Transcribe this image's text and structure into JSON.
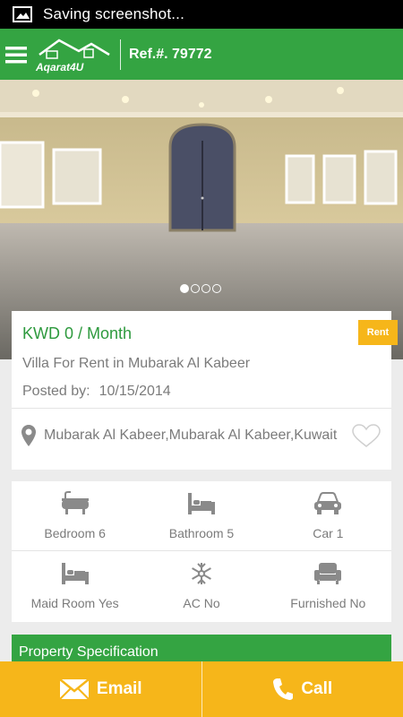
{
  "status_bar": {
    "text": "Saving screenshot..."
  },
  "header": {
    "logo_text": "Aqarat4U",
    "ref": "Ref.#. 79772"
  },
  "hero": {
    "slides": 4,
    "active_slide": 1
  },
  "listing": {
    "price": "KWD 0 / Month",
    "badge": "Rent",
    "title": "Villa For Rent in Mubarak Al Kabeer",
    "posted_label": "Posted by:",
    "posted_date": "10/15/2014",
    "location": "Mubarak Al Kabeer,Mubarak Al Kabeer,Kuwait"
  },
  "features": [
    {
      "icon": "bathtub-icon",
      "label": "Bedroom 6"
    },
    {
      "icon": "bed-icon",
      "label": "Bathroom 5"
    },
    {
      "icon": "car-icon",
      "label": "Car 1"
    },
    {
      "icon": "bed-icon",
      "label": "Maid Room Yes"
    },
    {
      "icon": "snowflake-icon",
      "label": "AC No"
    },
    {
      "icon": "armchair-icon",
      "label": "Furnished No"
    }
  ],
  "spec": {
    "title": "Property Specification"
  },
  "actions": {
    "email": "Email",
    "call": "Call"
  },
  "colors": {
    "primary_green": "#34a442",
    "accent_yellow": "#f6b61a",
    "price_green": "#2e9a3e"
  }
}
